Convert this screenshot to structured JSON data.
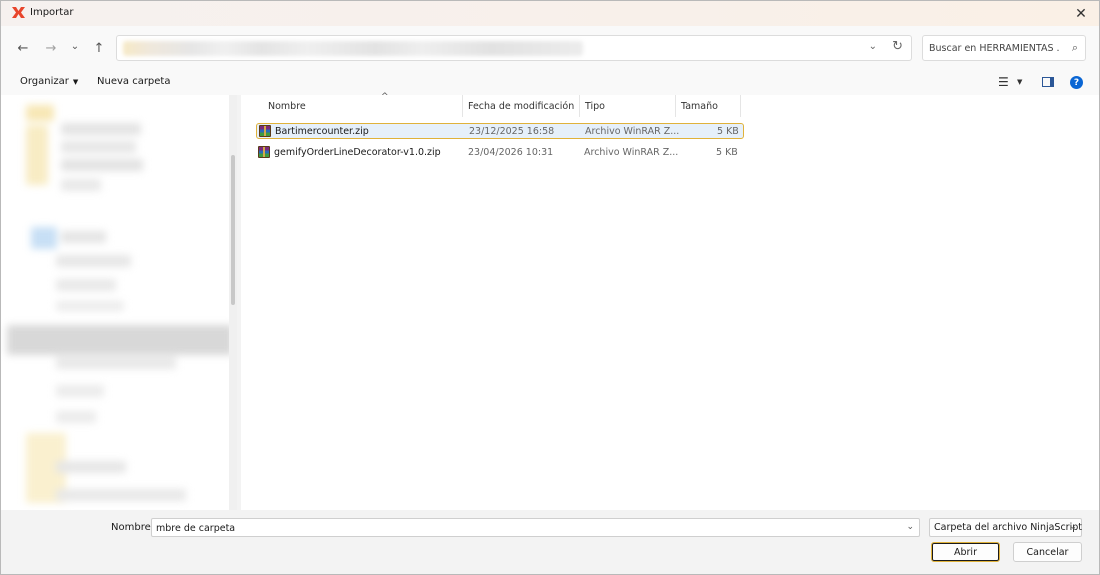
{
  "window": {
    "title": "Importar",
    "close_glyph": "✕"
  },
  "nav": {
    "back_glyph": "←",
    "forward_glyph": "→",
    "recent_glyph": "⌄",
    "up_glyph": "↑",
    "address_chevron": "⌄",
    "refresh_glyph": "↻",
    "search_placeholder": "Buscar en HERRAMIENTAS ...",
    "search_glyph": "⌕"
  },
  "toolbar": {
    "organize_label": "Organizar",
    "organize_caret": "▼",
    "new_folder_label": "Nueva carpeta",
    "view_glyph": "☰",
    "view_caret": "▼",
    "help_glyph": "?"
  },
  "columns": {
    "name": "Nombre",
    "date": "Fecha de modificación",
    "type": "Tipo",
    "size": "Tamaño",
    "sort_glyph": "^"
  },
  "files": [
    {
      "name": "Bartimercounter.zip",
      "date": "23/12/2025 16:58",
      "type": "Archivo WinRAR Z...",
      "size": "5 KB",
      "selected": true
    },
    {
      "name": "gemifyOrderLineDecorator-v1.0.zip",
      "date": "23/04/2026 10:31",
      "type": "Archivo WinRAR Z...",
      "size": "5 KB",
      "selected": false
    }
  ],
  "bottom": {
    "name_label": "Nombre:",
    "name_value": "mbre de carpeta",
    "name_chevron": "⌄",
    "filter_value": "Carpeta del archivo NinjaScript",
    "filter_chevron": "⌄",
    "open_label": "Abrir",
    "cancel_label": "Cancelar"
  },
  "colors": {
    "accent": "#0a66d4",
    "selection_border": "#e0b23a",
    "selection_fill": "#e6f0fa",
    "app_icon": "#e8452c"
  }
}
